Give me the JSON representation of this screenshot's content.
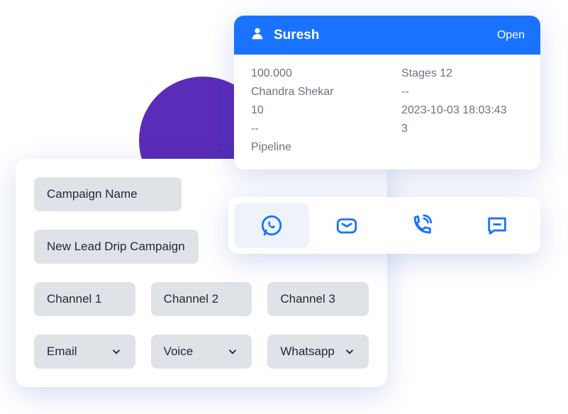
{
  "contact": {
    "name": "Suresh",
    "status": "Open",
    "left_col": [
      "100.000",
      "Chandra Shekar",
      "10",
      "--",
      "Pipeline"
    ],
    "right_col": [
      "Stages 12",
      "--",
      "2023-10-03 18:03:43",
      "3"
    ]
  },
  "channel_icons": [
    "whatsapp",
    "mail",
    "phone",
    "sms"
  ],
  "campaign": {
    "name_label": "Campaign Name",
    "name_value": "New Lead Drip Campaign",
    "channel_labels": [
      "Channel 1",
      "Channel 2",
      "Channel 3"
    ],
    "channel_values": [
      "Email",
      "Voice",
      "Whatsapp"
    ]
  }
}
